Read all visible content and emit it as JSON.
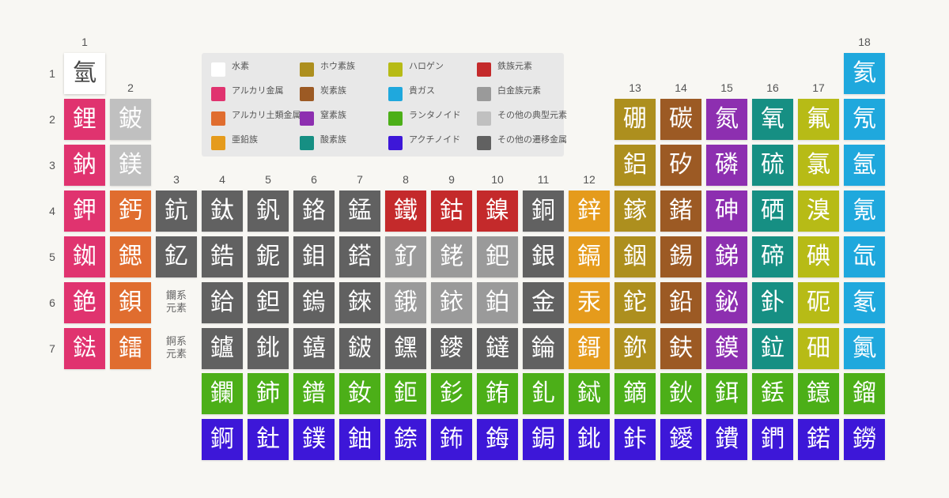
{
  "colors": {
    "hydrogen": "#ffffff",
    "alkali": "#e0336f",
    "alkaline": "#e06d2f",
    "zinc": "#e59b1c",
    "boron": "#ad8f1e",
    "carbon": "#9c5a24",
    "nitrogen": "#8d2fb0",
    "oxygen": "#168f83",
    "halogen": "#b7bb16",
    "noble": "#1fa8dd",
    "lanthanoid": "#4caf18",
    "actinoid": "#3d17d8",
    "iron": "#c42a2b",
    "platinum": "#9a9a9a",
    "other": "#c0c0c0",
    "transition": "#616161"
  },
  "group_numbers": [
    "1",
    "2",
    "3",
    "4",
    "5",
    "6",
    "7",
    "8",
    "9",
    "10",
    "11",
    "12",
    "13",
    "14",
    "15",
    "16",
    "17",
    "18"
  ],
  "period_numbers": [
    "1",
    "2",
    "3",
    "4",
    "5",
    "6",
    "7"
  ],
  "placeholders": {
    "lanthanoid": [
      "鑭系",
      "元素"
    ],
    "actinoid": [
      "錒系",
      "元素"
    ]
  },
  "legend": [
    {
      "cat": "hydrogen",
      "label": "水素"
    },
    {
      "cat": "alkali",
      "label": "アルカリ金属"
    },
    {
      "cat": "alkaline",
      "label": "アルカリ土類金属"
    },
    {
      "cat": "zinc",
      "label": "亜鉛族"
    },
    {
      "cat": "boron",
      "label": "ホウ素族"
    },
    {
      "cat": "carbon",
      "label": "炭素族"
    },
    {
      "cat": "nitrogen",
      "label": "窒素族"
    },
    {
      "cat": "oxygen",
      "label": "酸素族"
    },
    {
      "cat": "halogen",
      "label": "ハロゲン"
    },
    {
      "cat": "noble",
      "label": "貴ガス"
    },
    {
      "cat": "lanthanoid",
      "label": "ランタノイド"
    },
    {
      "cat": "actinoid",
      "label": "アクチノイド"
    },
    {
      "cat": "iron",
      "label": "鉄族元素"
    },
    {
      "cat": "platinum",
      "label": "白金族元素"
    },
    {
      "cat": "other",
      "label": "その他の典型元素"
    },
    {
      "cat": "transition",
      "label": "その他の遷移金属"
    }
  ],
  "elements": [
    {
      "ch": "氫",
      "p": 1,
      "g": 1,
      "cat": "hydrogen"
    },
    {
      "ch": "氦",
      "p": 1,
      "g": 18,
      "cat": "noble"
    },
    {
      "ch": "鋰",
      "p": 2,
      "g": 1,
      "cat": "alkali"
    },
    {
      "ch": "鈹",
      "p": 2,
      "g": 2,
      "cat": "other"
    },
    {
      "ch": "硼",
      "p": 2,
      "g": 13,
      "cat": "boron"
    },
    {
      "ch": "碳",
      "p": 2,
      "g": 14,
      "cat": "carbon"
    },
    {
      "ch": "氮",
      "p": 2,
      "g": 15,
      "cat": "nitrogen"
    },
    {
      "ch": "氧",
      "p": 2,
      "g": 16,
      "cat": "oxygen"
    },
    {
      "ch": "氟",
      "p": 2,
      "g": 17,
      "cat": "halogen"
    },
    {
      "ch": "氖",
      "p": 2,
      "g": 18,
      "cat": "noble"
    },
    {
      "ch": "鈉",
      "p": 3,
      "g": 1,
      "cat": "alkali"
    },
    {
      "ch": "鎂",
      "p": 3,
      "g": 2,
      "cat": "other"
    },
    {
      "ch": "鋁",
      "p": 3,
      "g": 13,
      "cat": "boron"
    },
    {
      "ch": "矽",
      "p": 3,
      "g": 14,
      "cat": "carbon"
    },
    {
      "ch": "磷",
      "p": 3,
      "g": 15,
      "cat": "nitrogen"
    },
    {
      "ch": "硫",
      "p": 3,
      "g": 16,
      "cat": "oxygen"
    },
    {
      "ch": "氯",
      "p": 3,
      "g": 17,
      "cat": "halogen"
    },
    {
      "ch": "氬",
      "p": 3,
      "g": 18,
      "cat": "noble"
    },
    {
      "ch": "鉀",
      "p": 4,
      "g": 1,
      "cat": "alkali"
    },
    {
      "ch": "鈣",
      "p": 4,
      "g": 2,
      "cat": "alkaline"
    },
    {
      "ch": "鈧",
      "p": 4,
      "g": 3,
      "cat": "transition"
    },
    {
      "ch": "鈦",
      "p": 4,
      "g": 4,
      "cat": "transition"
    },
    {
      "ch": "釩",
      "p": 4,
      "g": 5,
      "cat": "transition"
    },
    {
      "ch": "鉻",
      "p": 4,
      "g": 6,
      "cat": "transition"
    },
    {
      "ch": "錳",
      "p": 4,
      "g": 7,
      "cat": "transition"
    },
    {
      "ch": "鐵",
      "p": 4,
      "g": 8,
      "cat": "iron"
    },
    {
      "ch": "鈷",
      "p": 4,
      "g": 9,
      "cat": "iron"
    },
    {
      "ch": "鎳",
      "p": 4,
      "g": 10,
      "cat": "iron"
    },
    {
      "ch": "銅",
      "p": 4,
      "g": 11,
      "cat": "transition"
    },
    {
      "ch": "鋅",
      "p": 4,
      "g": 12,
      "cat": "zinc"
    },
    {
      "ch": "鎵",
      "p": 4,
      "g": 13,
      "cat": "boron"
    },
    {
      "ch": "鍺",
      "p": 4,
      "g": 14,
      "cat": "carbon"
    },
    {
      "ch": "砷",
      "p": 4,
      "g": 15,
      "cat": "nitrogen"
    },
    {
      "ch": "硒",
      "p": 4,
      "g": 16,
      "cat": "oxygen"
    },
    {
      "ch": "溴",
      "p": 4,
      "g": 17,
      "cat": "halogen"
    },
    {
      "ch": "氪",
      "p": 4,
      "g": 18,
      "cat": "noble"
    },
    {
      "ch": "銣",
      "p": 5,
      "g": 1,
      "cat": "alkali"
    },
    {
      "ch": "鍶",
      "p": 5,
      "g": 2,
      "cat": "alkaline"
    },
    {
      "ch": "釔",
      "p": 5,
      "g": 3,
      "cat": "transition"
    },
    {
      "ch": "鋯",
      "p": 5,
      "g": 4,
      "cat": "transition"
    },
    {
      "ch": "鈮",
      "p": 5,
      "g": 5,
      "cat": "transition"
    },
    {
      "ch": "鉬",
      "p": 5,
      "g": 6,
      "cat": "transition"
    },
    {
      "ch": "鎝",
      "p": 5,
      "g": 7,
      "cat": "transition"
    },
    {
      "ch": "釕",
      "p": 5,
      "g": 8,
      "cat": "platinum"
    },
    {
      "ch": "銠",
      "p": 5,
      "g": 9,
      "cat": "platinum"
    },
    {
      "ch": "鈀",
      "p": 5,
      "g": 10,
      "cat": "platinum"
    },
    {
      "ch": "銀",
      "p": 5,
      "g": 11,
      "cat": "transition"
    },
    {
      "ch": "鎘",
      "p": 5,
      "g": 12,
      "cat": "zinc"
    },
    {
      "ch": "銦",
      "p": 5,
      "g": 13,
      "cat": "boron"
    },
    {
      "ch": "錫",
      "p": 5,
      "g": 14,
      "cat": "carbon"
    },
    {
      "ch": "銻",
      "p": 5,
      "g": 15,
      "cat": "nitrogen"
    },
    {
      "ch": "碲",
      "p": 5,
      "g": 16,
      "cat": "oxygen"
    },
    {
      "ch": "碘",
      "p": 5,
      "g": 17,
      "cat": "halogen"
    },
    {
      "ch": "氙",
      "p": 5,
      "g": 18,
      "cat": "noble"
    },
    {
      "ch": "銫",
      "p": 6,
      "g": 1,
      "cat": "alkali"
    },
    {
      "ch": "鋇",
      "p": 6,
      "g": 2,
      "cat": "alkaline"
    },
    {
      "ch": "鉿",
      "p": 6,
      "g": 4,
      "cat": "transition"
    },
    {
      "ch": "鉭",
      "p": 6,
      "g": 5,
      "cat": "transition"
    },
    {
      "ch": "鎢",
      "p": 6,
      "g": 6,
      "cat": "transition"
    },
    {
      "ch": "錸",
      "p": 6,
      "g": 7,
      "cat": "transition"
    },
    {
      "ch": "鋨",
      "p": 6,
      "g": 8,
      "cat": "platinum"
    },
    {
      "ch": "銥",
      "p": 6,
      "g": 9,
      "cat": "platinum"
    },
    {
      "ch": "鉑",
      "p": 6,
      "g": 10,
      "cat": "platinum"
    },
    {
      "ch": "金",
      "p": 6,
      "g": 11,
      "cat": "transition"
    },
    {
      "ch": "汞",
      "p": 6,
      "g": 12,
      "cat": "zinc"
    },
    {
      "ch": "鉈",
      "p": 6,
      "g": 13,
      "cat": "boron"
    },
    {
      "ch": "鉛",
      "p": 6,
      "g": 14,
      "cat": "carbon"
    },
    {
      "ch": "鉍",
      "p": 6,
      "g": 15,
      "cat": "nitrogen"
    },
    {
      "ch": "釙",
      "p": 6,
      "g": 16,
      "cat": "oxygen"
    },
    {
      "ch": "砈",
      "p": 6,
      "g": 17,
      "cat": "halogen"
    },
    {
      "ch": "氡",
      "p": 6,
      "g": 18,
      "cat": "noble"
    },
    {
      "ch": "鍅",
      "p": 7,
      "g": 1,
      "cat": "alkali"
    },
    {
      "ch": "鐳",
      "p": 7,
      "g": 2,
      "cat": "alkaline"
    },
    {
      "ch": "鑪",
      "p": 7,
      "g": 4,
      "cat": "transition"
    },
    {
      "ch": "鉳",
      "p": 7,
      "g": 5,
      "cat": "transition"
    },
    {
      "ch": "𨭎",
      "p": 7,
      "g": 6,
      "cat": "transition"
    },
    {
      "ch": "𨨏",
      "p": 7,
      "g": 7,
      "cat": "transition"
    },
    {
      "ch": "𨭆",
      "p": 7,
      "g": 8,
      "cat": "transition"
    },
    {
      "ch": "䥑",
      "p": 7,
      "g": 9,
      "cat": "transition"
    },
    {
      "ch": "鐽",
      "p": 7,
      "g": 10,
      "cat": "transition"
    },
    {
      "ch": "錀",
      "p": 7,
      "g": 11,
      "cat": "transition"
    },
    {
      "ch": "鎶",
      "p": 7,
      "g": 12,
      "cat": "zinc"
    },
    {
      "ch": "鉨",
      "p": 7,
      "g": 13,
      "cat": "boron"
    },
    {
      "ch": "鈇",
      "p": 7,
      "g": 14,
      "cat": "carbon"
    },
    {
      "ch": "鏌",
      "p": 7,
      "g": 15,
      "cat": "nitrogen"
    },
    {
      "ch": "鉝",
      "p": 7,
      "g": 16,
      "cat": "oxygen"
    },
    {
      "ch": "鿬",
      "p": 7,
      "g": 17,
      "cat": "halogen"
    },
    {
      "ch": "鿫",
      "p": 7,
      "g": 18,
      "cat": "noble"
    },
    {
      "ch": "鑭",
      "p": 8,
      "g": 4,
      "cat": "lanthanoid"
    },
    {
      "ch": "鈰",
      "p": 8,
      "g": 5,
      "cat": "lanthanoid"
    },
    {
      "ch": "鐠",
      "p": 8,
      "g": 6,
      "cat": "lanthanoid"
    },
    {
      "ch": "釹",
      "p": 8,
      "g": 7,
      "cat": "lanthanoid"
    },
    {
      "ch": "鉕",
      "p": 8,
      "g": 8,
      "cat": "lanthanoid"
    },
    {
      "ch": "釤",
      "p": 8,
      "g": 9,
      "cat": "lanthanoid"
    },
    {
      "ch": "銪",
      "p": 8,
      "g": 10,
      "cat": "lanthanoid"
    },
    {
      "ch": "釓",
      "p": 8,
      "g": 11,
      "cat": "lanthanoid"
    },
    {
      "ch": "鋱",
      "p": 8,
      "g": 12,
      "cat": "lanthanoid"
    },
    {
      "ch": "鏑",
      "p": 8,
      "g": 13,
      "cat": "lanthanoid"
    },
    {
      "ch": "鈥",
      "p": 8,
      "g": 14,
      "cat": "lanthanoid"
    },
    {
      "ch": "鉺",
      "p": 8,
      "g": 15,
      "cat": "lanthanoid"
    },
    {
      "ch": "銩",
      "p": 8,
      "g": 16,
      "cat": "lanthanoid"
    },
    {
      "ch": "鐿",
      "p": 8,
      "g": 17,
      "cat": "lanthanoid"
    },
    {
      "ch": "鎦",
      "p": 8,
      "g": 18,
      "cat": "lanthanoid"
    },
    {
      "ch": "錒",
      "p": 9,
      "g": 4,
      "cat": "actinoid"
    },
    {
      "ch": "釷",
      "p": 9,
      "g": 5,
      "cat": "actinoid"
    },
    {
      "ch": "鏷",
      "p": 9,
      "g": 6,
      "cat": "actinoid"
    },
    {
      "ch": "鈾",
      "p": 9,
      "g": 7,
      "cat": "actinoid"
    },
    {
      "ch": "錼",
      "p": 9,
      "g": 8,
      "cat": "actinoid"
    },
    {
      "ch": "鈽",
      "p": 9,
      "g": 9,
      "cat": "actinoid"
    },
    {
      "ch": "鋂",
      "p": 9,
      "g": 10,
      "cat": "actinoid"
    },
    {
      "ch": "鋦",
      "p": 9,
      "g": 11,
      "cat": "actinoid"
    },
    {
      "ch": "鉳",
      "p": 9,
      "g": 12,
      "cat": "actinoid"
    },
    {
      "ch": "鉲",
      "p": 9,
      "g": 13,
      "cat": "actinoid"
    },
    {
      "ch": "鑀",
      "p": 9,
      "g": 14,
      "cat": "actinoid"
    },
    {
      "ch": "鐨",
      "p": 9,
      "g": 15,
      "cat": "actinoid"
    },
    {
      "ch": "鍆",
      "p": 9,
      "g": 16,
      "cat": "actinoid"
    },
    {
      "ch": "鍩",
      "p": 9,
      "g": 17,
      "cat": "actinoid"
    },
    {
      "ch": "鐒",
      "p": 9,
      "g": 18,
      "cat": "actinoid"
    }
  ]
}
